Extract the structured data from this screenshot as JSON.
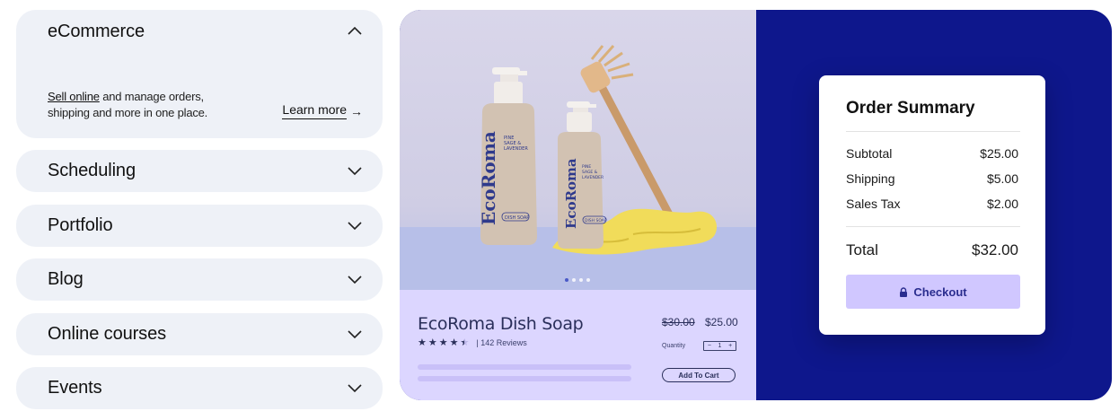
{
  "accordion": {
    "ecommerce": {
      "title": "eCommerce",
      "desc_link": "Sell online",
      "desc_line1_rest": " and manage orders,",
      "desc_line2": "shipping and more in one place.",
      "learn_more": "Learn more",
      "arrow": "→"
    },
    "scheduling": {
      "title": "Scheduling"
    },
    "portfolio": {
      "title": "Portfolio"
    },
    "blog": {
      "title": "Blog"
    },
    "online_courses": {
      "title": "Online courses"
    },
    "events": {
      "title": "Events"
    }
  },
  "product": {
    "name": "EcoRoma Dish Soap",
    "brand": "EcoRoma",
    "scent": "PINE SAGE & LAVENDER",
    "label": "DISH SOAP",
    "rating": 4.5,
    "reviews": "142 Reviews",
    "old_price": "$30.00",
    "price": "$25.00",
    "quantity_label": "Quantity",
    "quantity_minus": "−",
    "quantity_value": "1",
    "quantity_plus": "+",
    "add_to_cart": "Add To Cart",
    "carousel_total": 4,
    "carousel_active": 1
  },
  "order_summary": {
    "title": "Order Summary",
    "rows": [
      {
        "label": "Subtotal",
        "value": "$25.00"
      },
      {
        "label": "Shipping",
        "value": "$5.00"
      },
      {
        "label": "Sales Tax",
        "value": "$2.00"
      }
    ],
    "total_label": "Total",
    "total_value": "$32.00",
    "checkout": "Checkout"
  },
  "colors": {
    "accordion_bg": "#eef1f7",
    "showcase_bg": "#0e178c",
    "product_info_bg": "#dcd6ff",
    "checkout_bg": "#d0c7ff",
    "checkout_text": "#2a2d8f"
  },
  "icons": {
    "chevron_up": "chevron-up-icon",
    "chevron_down": "chevron-down-icon",
    "lock": "lock-icon",
    "star": "star-icon"
  }
}
